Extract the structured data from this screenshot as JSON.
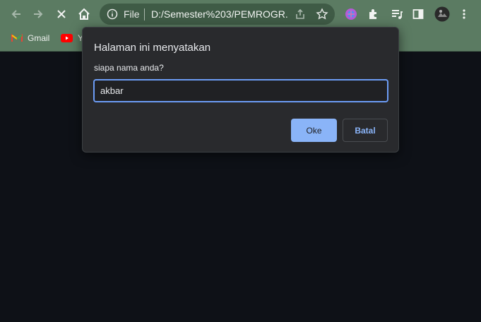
{
  "browser": {
    "address_bar": {
      "scheme_label": "File",
      "url": "D:/Semester%203/PEMROGR..."
    },
    "bookmarks": [
      {
        "label": "Gmail",
        "icon": "gmail-icon"
      },
      {
        "label": "Y",
        "icon": "youtube-icon"
      }
    ],
    "colors": {
      "toolbar": "#5b7b62",
      "page_background": "#0e1117",
      "accent": "#8ab4f8"
    }
  },
  "dialog": {
    "title": "Halaman ini menyatakan",
    "message": "siapa nama anda?",
    "input_value": "akbar",
    "ok_label": "Oke",
    "cancel_label": "Batal"
  }
}
